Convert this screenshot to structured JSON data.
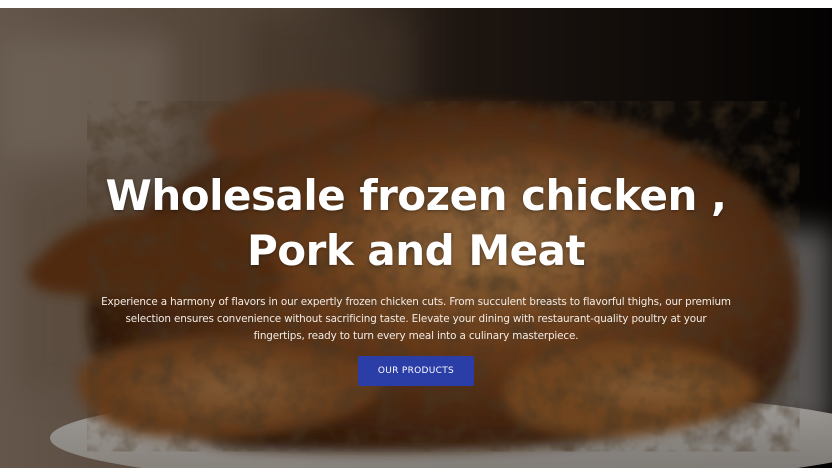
{
  "hero": {
    "headline_line1": "Wholesale frozen chicken ,",
    "headline_line2": "Pork and Meat",
    "description": "Experience a harmony of flavors in our expertly frozen chicken cuts. From succulent breasts to flavorful thighs, our premium selection ensures convenience without sacrificing taste. Elevate your dining with restaurant-quality poultry at your fingertips, ready to turn every meal into a culinary masterpiece.",
    "cta_label": "OUR PRODUCTS",
    "background_image": "roast-chicken-photo"
  },
  "colors": {
    "cta_background": "#2b3da6",
    "headline_text": "#ffffff",
    "overlay": "#000000"
  }
}
